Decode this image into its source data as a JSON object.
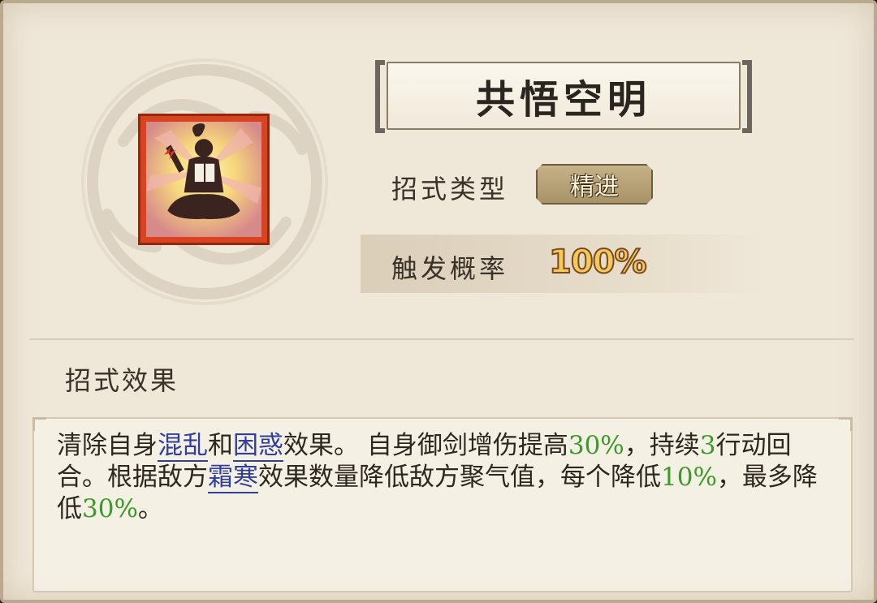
{
  "skill": {
    "name": "共悟空明",
    "icon": "meditating-reader-icon"
  },
  "attributes": {
    "type_label": "招式类型",
    "type_value": "精进",
    "prob_label": "触发概率",
    "prob_value": "100%"
  },
  "effect": {
    "section_title": "招式效果",
    "segments": [
      {
        "text": "清除自身",
        "kind": "plain"
      },
      {
        "text": "混乱",
        "kind": "keyword"
      },
      {
        "text": "和",
        "kind": "plain"
      },
      {
        "text": "困惑",
        "kind": "keyword"
      },
      {
        "text": "效果。 自身御剑增伤提高",
        "kind": "plain"
      },
      {
        "text": "30%",
        "kind": "number"
      },
      {
        "text": "，持续",
        "kind": "plain"
      },
      {
        "text": "3",
        "kind": "number"
      },
      {
        "text": "行动回合。根据敌方",
        "kind": "plain"
      },
      {
        "text": "霜寒",
        "kind": "keyword"
      },
      {
        "text": "效果数量降低敌方聚气值，每个降低",
        "kind": "plain"
      },
      {
        "text": "10%",
        "kind": "number"
      },
      {
        "text": "，最多降低",
        "kind": "plain"
      },
      {
        "text": "30%",
        "kind": "number"
      },
      {
        "text": "。",
        "kind": "plain"
      }
    ]
  },
  "colors": {
    "keyword": "#2f3f9a",
    "number": "#3c9a2a",
    "icon_frame": "#d9431f"
  }
}
